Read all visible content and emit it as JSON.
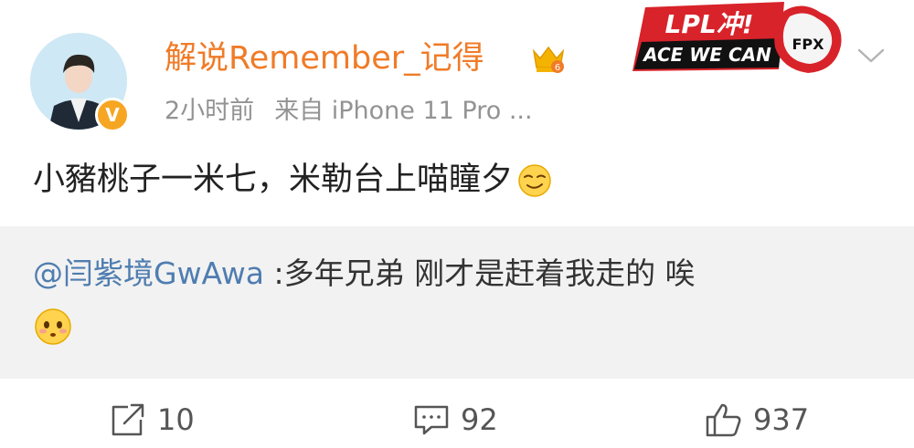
{
  "post": {
    "username": "解说Remember_记得",
    "time": "2小时前",
    "source": "来自 iPhone 11 Pro ...",
    "content": "小豬桃子一米七，米勒台上喵瞳夕",
    "content_emoji": "smirk-emoji",
    "fan_badge": {
      "top_text": "LPL冲!",
      "bottom_text": "ACE WE CAN",
      "team": "FPX"
    }
  },
  "repost": {
    "mention": "@闫紫境GwAwa",
    "text": " :多年兄弟 刚才是赶着我走的 唉",
    "emoji": "blush-emoji"
  },
  "actions": {
    "repost_count": "10",
    "comment_count": "92",
    "like_count": "937"
  },
  "colors": {
    "username": "#f07b27",
    "mention": "#4f7db0",
    "repost_bg": "#f2f2f2",
    "badge_red": "#d8232a"
  }
}
